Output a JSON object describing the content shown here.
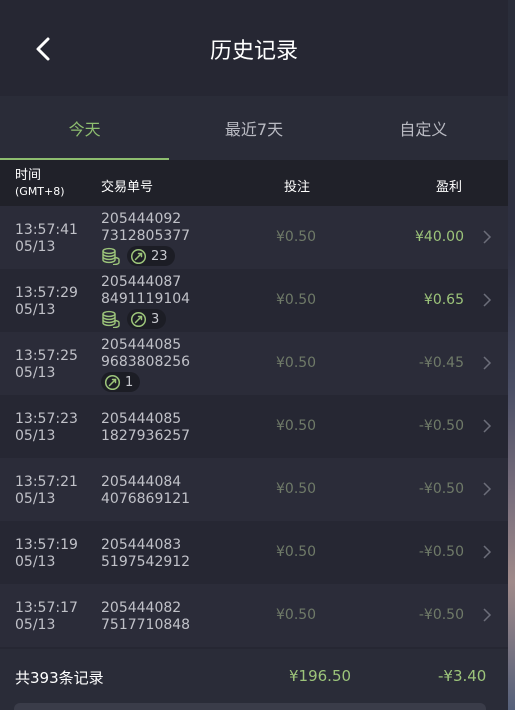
{
  "header": {
    "title": "历史记录"
  },
  "tabs": [
    {
      "label": "今天",
      "active": true
    },
    {
      "label": "最近7天",
      "active": false
    },
    {
      "label": "自定义",
      "active": false
    }
  ],
  "columns": {
    "time": "时间",
    "timezone": "(GMT+8)",
    "order": "交易单号",
    "bet": "投注",
    "profit": "盈利"
  },
  "rows": [
    {
      "time": "13:57:41",
      "date": "05/13",
      "order_a": "205444092",
      "order_b": "7312805377",
      "coin_badge": true,
      "pill_count": "23",
      "bet": "¥0.50",
      "profit": "¥40.00",
      "profit_positive": true
    },
    {
      "time": "13:57:29",
      "date": "05/13",
      "order_a": "205444087",
      "order_b": "8491119104",
      "coin_badge": true,
      "pill_count": "3",
      "bet": "¥0.50",
      "profit": "¥0.65",
      "profit_positive": true
    },
    {
      "time": "13:57:25",
      "date": "05/13",
      "order_a": "205444085",
      "order_b": "9683808256",
      "coin_badge": false,
      "pill_count": "1",
      "bet": "¥0.50",
      "profit": "-¥0.45",
      "profit_positive": false
    },
    {
      "time": "13:57:23",
      "date": "05/13",
      "order_a": "205444085",
      "order_b": "1827936257",
      "bet": "¥0.50",
      "profit": "-¥0.50",
      "profit_positive": false
    },
    {
      "time": "13:57:21",
      "date": "05/13",
      "order_a": "205444084",
      "order_b": "4076869121",
      "bet": "¥0.50",
      "profit": "-¥0.50",
      "profit_positive": false
    },
    {
      "time": "13:57:19",
      "date": "05/13",
      "order_a": "205444083",
      "order_b": "5197542912",
      "bet": "¥0.50",
      "profit": "-¥0.50",
      "profit_positive": false
    },
    {
      "time": "13:57:17",
      "date": "05/13",
      "order_a": "205444082",
      "order_b": "7517710848",
      "bet": "¥0.50",
      "profit": "-¥0.50",
      "profit_positive": false
    }
  ],
  "footer": {
    "count_label": "共393条记录",
    "total_bet": "¥196.50",
    "total_profit": "-¥3.40"
  },
  "icons": {
    "back": "chevron-left-icon",
    "row_arrow": "chevron-right-icon",
    "coin": "coin-stack-icon",
    "free_spin": "free-spin-icon"
  },
  "colors": {
    "accent": "#8dbd6f",
    "positive": "#9cc47a",
    "muted": "#6f7a68",
    "background": "#262733"
  }
}
